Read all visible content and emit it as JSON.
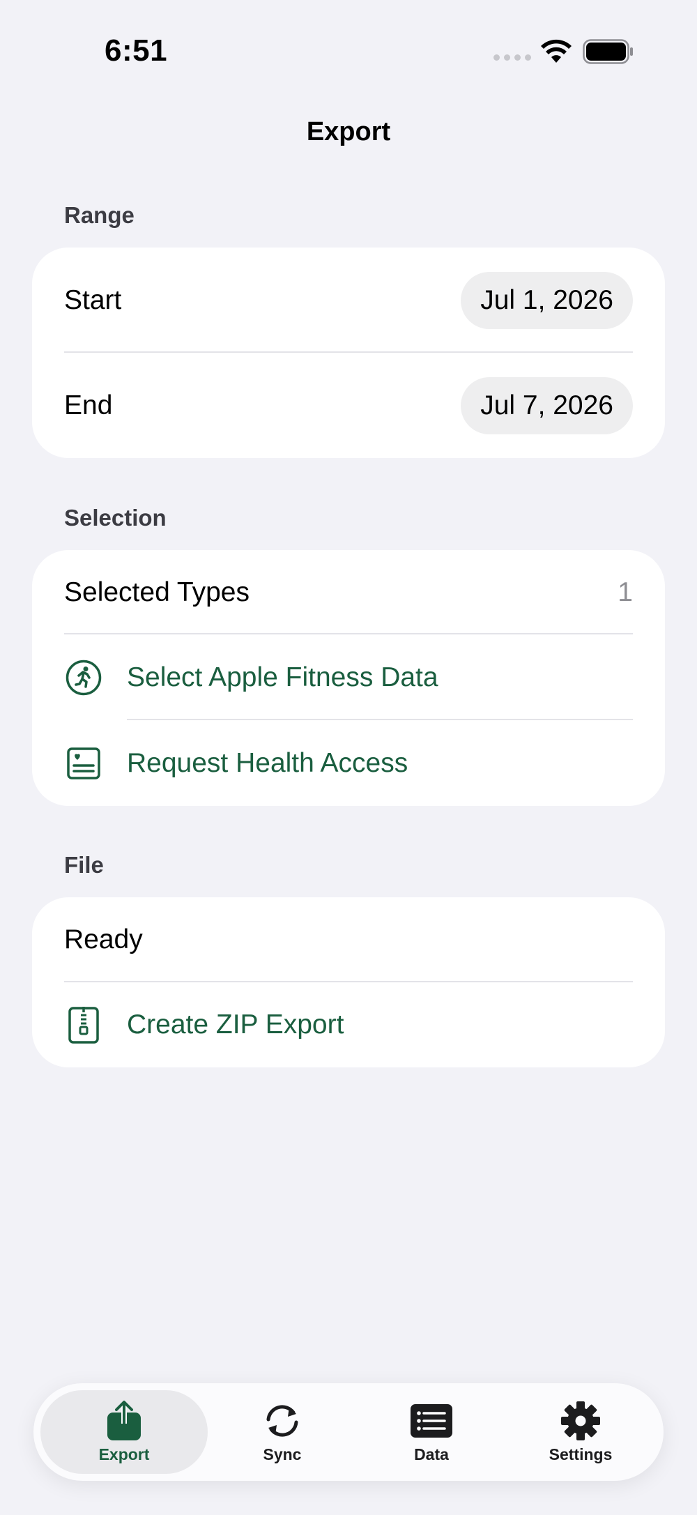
{
  "status_bar": {
    "time": "6:51"
  },
  "nav": {
    "title": "Export"
  },
  "range": {
    "header": "Range",
    "start_label": "Start",
    "start_value": "Jul 1, 2026",
    "end_label": "End",
    "end_value": "Jul 7, 2026"
  },
  "selection": {
    "header": "Selection",
    "selected_types_label": "Selected Types",
    "selected_types_count": "1",
    "select_fitness_label": "Select Apple Fitness Data",
    "request_health_label": "Request Health Access"
  },
  "file": {
    "header": "File",
    "status": "Ready",
    "create_zip_label": "Create ZIP Export"
  },
  "tab_bar": {
    "tabs": [
      {
        "label": "Export",
        "icon": "export-icon",
        "active": true
      },
      {
        "label": "Sync",
        "icon": "sync-icon",
        "active": false
      },
      {
        "label": "Data",
        "icon": "data-list-icon",
        "active": false
      },
      {
        "label": "Settings",
        "icon": "gear-icon",
        "active": false
      }
    ]
  },
  "colors": {
    "accent": "#1a5e3f",
    "background": "#f2f2f7",
    "card": "#ffffff"
  }
}
